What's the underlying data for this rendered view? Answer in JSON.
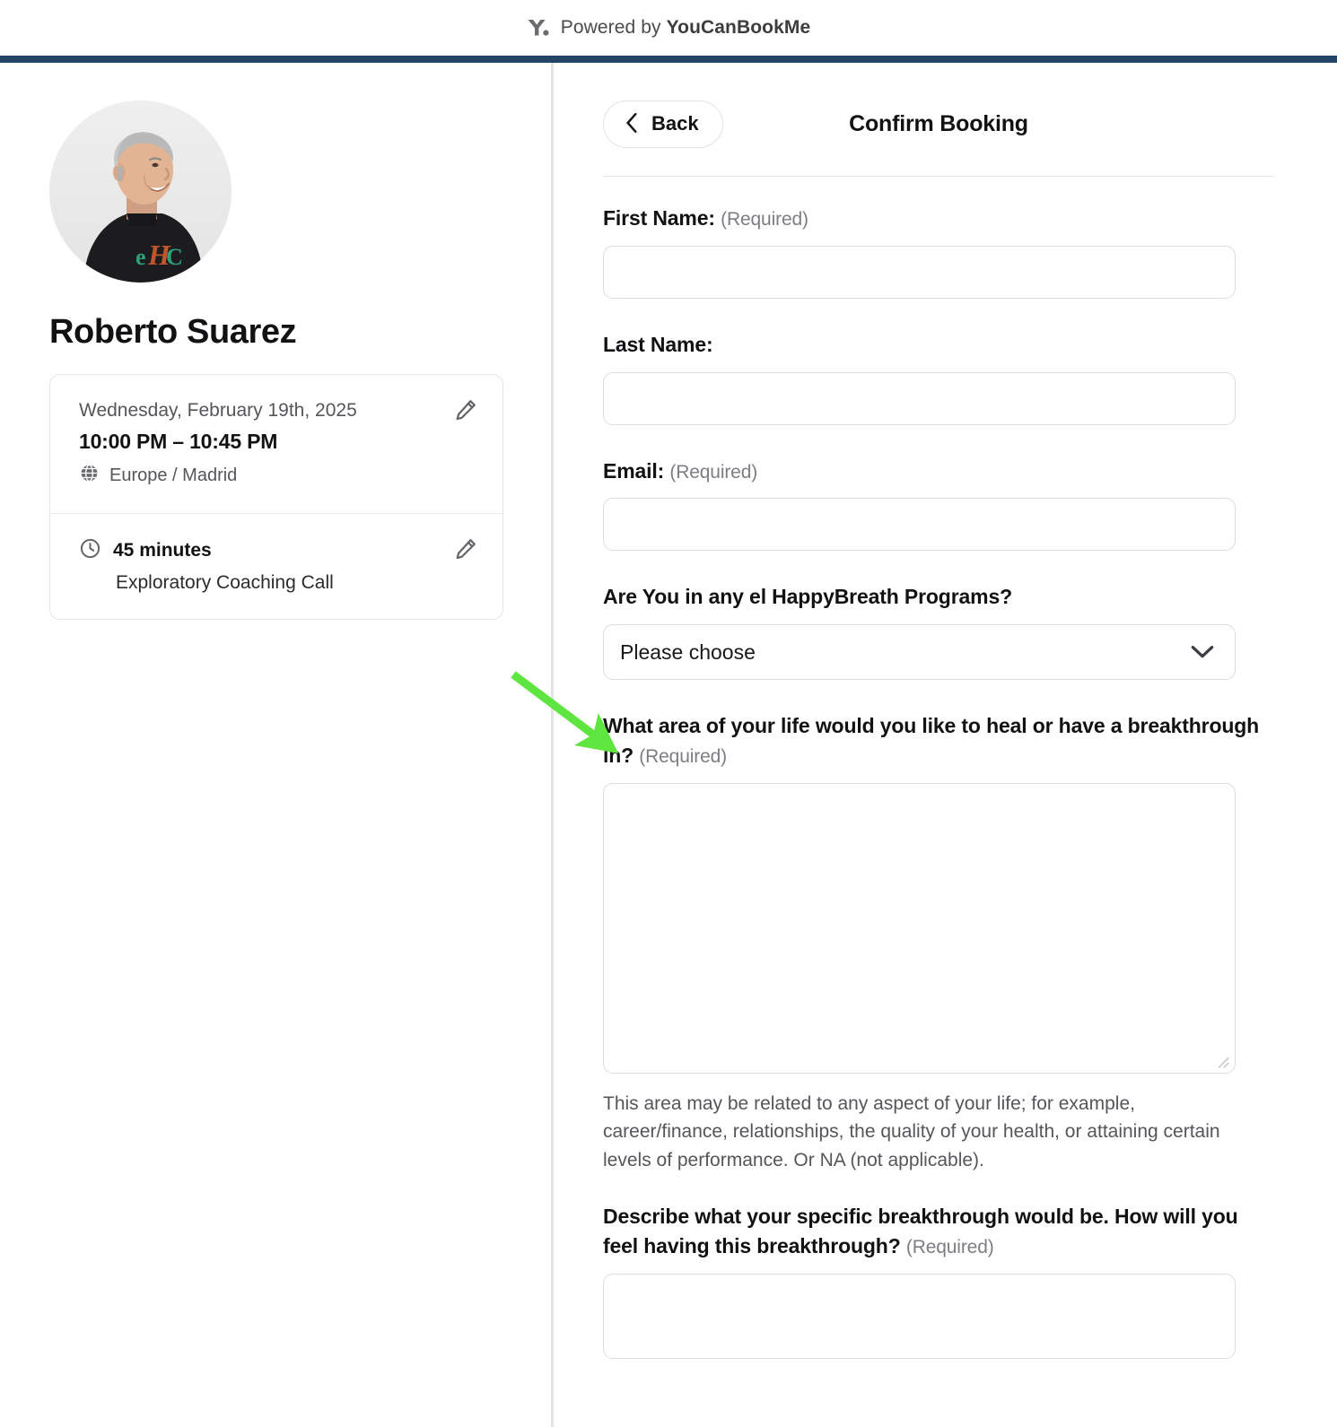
{
  "topbar": {
    "logo_icon": "ycbm-y-dot-logo",
    "prefix": "Powered by ",
    "brand": "YouCanBookMe",
    "rule_color": "#254567"
  },
  "sidebar": {
    "avatar_alt": "Roberto Suarez profile photo",
    "host_name": "Roberto Suarez",
    "booking": {
      "date": "Wednesday, February 19th, 2025",
      "time_range": "10:00 PM – 10:45 PM",
      "timezone_icon": "globe-icon",
      "timezone": "Europe / Madrid",
      "edit_icon": "pencil-icon"
    },
    "duration": {
      "clock_icon": "clock-icon",
      "value": "45 minutes",
      "event_name": "Exploratory Coaching Call",
      "edit_icon": "pencil-icon"
    }
  },
  "panel": {
    "back_icon": "chevron-left-icon",
    "back_label": "Back",
    "title": "Confirm Booking"
  },
  "form": {
    "required_note": "(Required)",
    "fields": [
      {
        "name": "first-name",
        "label": "First Name:",
        "required_note": "(Required)",
        "type": "text",
        "value": "",
        "placeholder": ""
      },
      {
        "name": "last-name",
        "label": "Last Name:",
        "required_note": "",
        "type": "text",
        "value": "",
        "placeholder": ""
      },
      {
        "name": "email",
        "label": "Email:",
        "required_note": "(Required)",
        "type": "text",
        "value": "",
        "placeholder": ""
      },
      {
        "name": "happybreath-programs",
        "label": "Are You in any el HappyBreath Programs?",
        "required_note": "",
        "type": "select",
        "value": "Please choose",
        "chevron_icon": "chevron-down-icon"
      },
      {
        "name": "heal-area",
        "label": "What area of your life would you like to heal or have a breakthrough in?",
        "required_note": "(Required)",
        "type": "textarea",
        "value": "",
        "help": "This area may be related to any aspect of your life; for example, career/finance, relationships, the quality of your health, or attaining certain levels of performance. Or NA (not applicable)."
      },
      {
        "name": "specific-breakthrough",
        "label": "Describe what your specific breakthrough would be. How will you feel having this breakthrough?",
        "required_note": "(Required)",
        "type": "textarea",
        "value": ""
      }
    ]
  },
  "annotation": {
    "type": "arrow",
    "color": "#5FE53F",
    "points_to": "heal-area-label"
  }
}
